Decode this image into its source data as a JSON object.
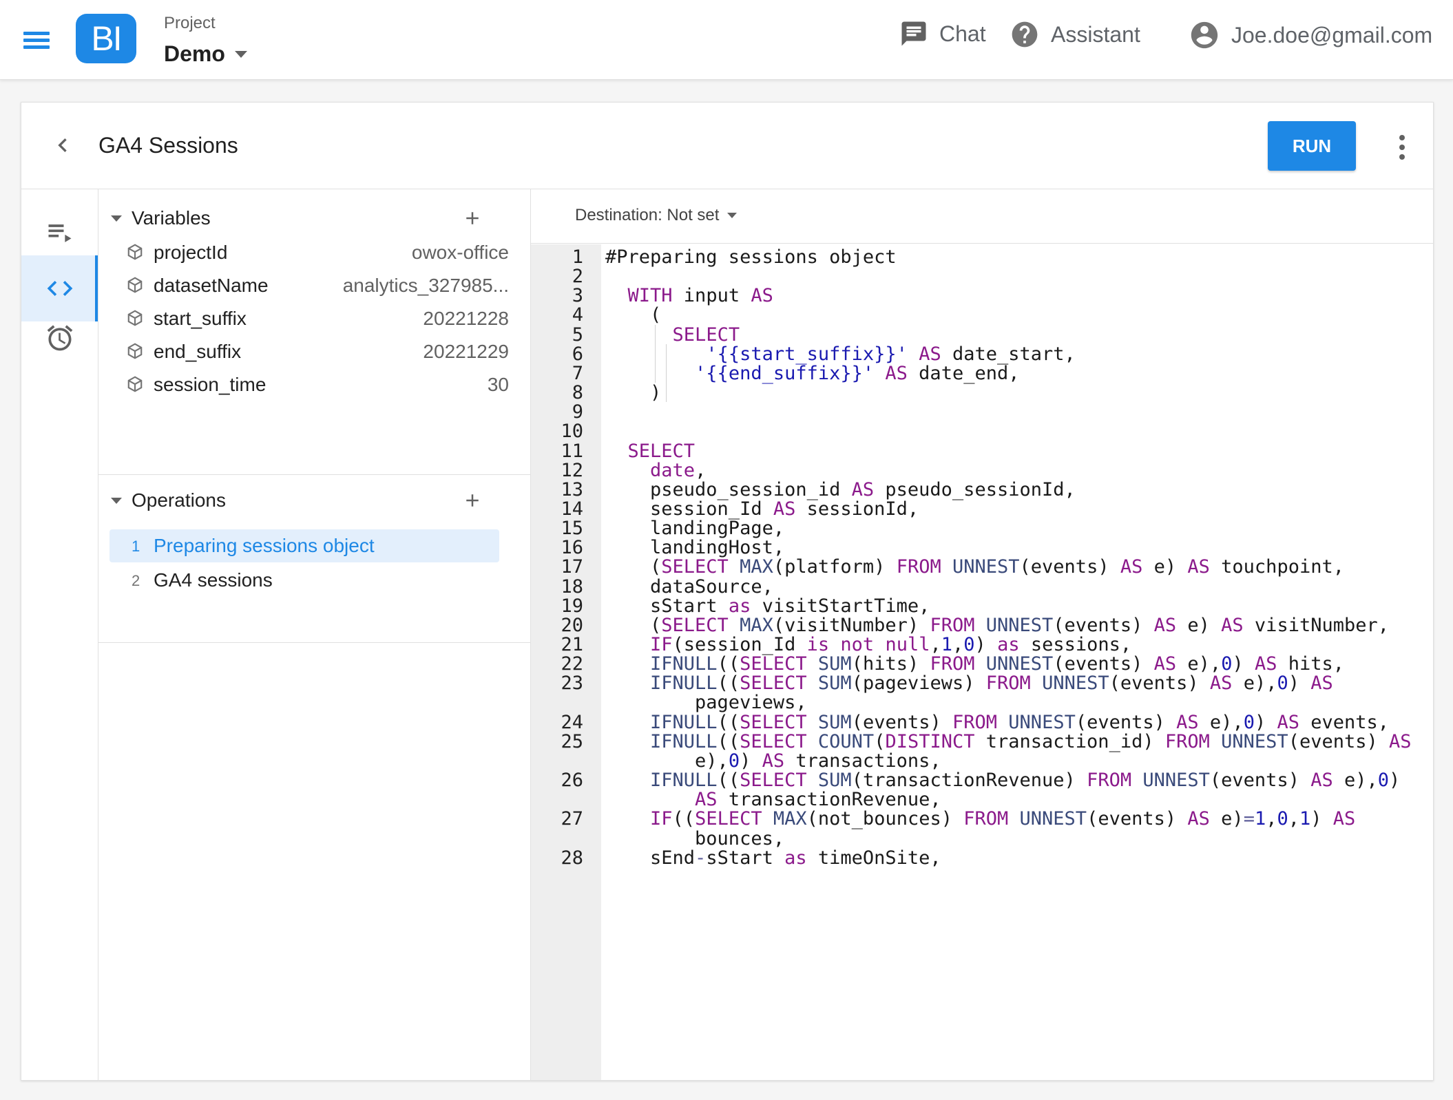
{
  "appbar": {
    "logo_text": "BI",
    "project_label": "Project",
    "project_name": "Demo",
    "chat_label": "Chat",
    "assistant_label": "Assistant",
    "user_email": "Joe.doe@gmail.com"
  },
  "query": {
    "title": "GA4 Sessions",
    "run_label": "RUN",
    "destination": "Destination: Not set"
  },
  "variables": {
    "header": "Variables",
    "items": [
      {
        "name": "projectId",
        "value": "owox-office"
      },
      {
        "name": "datasetName",
        "value": "analytics_327985..."
      },
      {
        "name": "start_suffix",
        "value": "20221228"
      },
      {
        "name": "end_suffix",
        "value": "20221229"
      },
      {
        "name": "session_time",
        "value": "30"
      }
    ]
  },
  "operations": {
    "header": "Operations",
    "items": [
      {
        "num": "1",
        "label": "Preparing sessions object",
        "active": true
      },
      {
        "num": "2",
        "label": "GA4 sessions",
        "active": false
      }
    ]
  },
  "editor": {
    "lines": [
      {
        "n": "1",
        "code": "#Preparing sessions object"
      },
      {
        "n": "2",
        "code": ""
      },
      {
        "n": "3",
        "code": "  WITH input AS"
      },
      {
        "n": "4",
        "code": "    ("
      },
      {
        "n": "5",
        "code": "      SELECT"
      },
      {
        "n": "6",
        "code": "         '{{start_suffix}}' AS date_start,"
      },
      {
        "n": "7",
        "code": "        '{{end_suffix}}' AS date_end,"
      },
      {
        "n": "8",
        "code": "    )"
      },
      {
        "n": "9",
        "code": ""
      },
      {
        "n": "10",
        "code": ""
      },
      {
        "n": "11",
        "code": "  SELECT"
      },
      {
        "n": "12",
        "code": "    date,"
      },
      {
        "n": "13",
        "code": "    pseudo_session_id AS pseudo_sessionId,"
      },
      {
        "n": "14",
        "code": "    session_Id AS sessionId,"
      },
      {
        "n": "15",
        "code": "    landingPage,"
      },
      {
        "n": "16",
        "code": "    landingHost,"
      },
      {
        "n": "17",
        "code": "    (SELECT MAX(platform) FROM UNNEST(events) AS e) AS touchpoint,"
      },
      {
        "n": "18",
        "code": "    dataSource,"
      },
      {
        "n": "19",
        "code": "    sStart as visitStartTime,"
      },
      {
        "n": "20",
        "code": "    (SELECT MAX(visitNumber) FROM UNNEST(events) AS e) AS visitNumber,"
      },
      {
        "n": "21",
        "code": "    IF(session_Id is not null,1,0) as sessions,"
      },
      {
        "n": "22",
        "code": "    IFNULL((SELECT SUM(hits) FROM UNNEST(events) AS e),0) AS hits,"
      },
      {
        "n": "23",
        "code": "    IFNULL((SELECT SUM(pageviews) FROM UNNEST(events) AS e),0) AS"
      },
      {
        "n": "",
        "code": "        pageviews,"
      },
      {
        "n": "24",
        "code": "    IFNULL((SELECT SUM(events) FROM UNNEST(events) AS e),0) AS events,"
      },
      {
        "n": "25",
        "code": "    IFNULL((SELECT COUNT(DISTINCT transaction_id) FROM UNNEST(events) AS"
      },
      {
        "n": "",
        "code": "        e),0) AS transactions,"
      },
      {
        "n": "26",
        "code": "    IFNULL((SELECT SUM(transactionRevenue) FROM UNNEST(events) AS e),0)"
      },
      {
        "n": "",
        "code": "        AS transactionRevenue,"
      },
      {
        "n": "27",
        "code": "    IF((SELECT MAX(not_bounces) FROM UNNEST(events) AS e)=1,0,1) AS"
      },
      {
        "n": "",
        "code": "        bounces,"
      },
      {
        "n": "28",
        "code": "    sEnd-sStart as timeOnSite,"
      }
    ]
  },
  "colors": {
    "accent": "#1e88e5",
    "keyword": "#8b1a8b",
    "function": "#3a4a7a",
    "string": "#1a1ab0"
  },
  "icons": {
    "menu": "menu-icon",
    "chat": "chat-icon",
    "assistant": "help-icon",
    "user": "account-icon",
    "back": "chevron-left-icon",
    "more": "more-vert-icon",
    "rail": [
      "playlist-play-icon",
      "code-icon",
      "alarm-icon"
    ],
    "variable": "cube-icon",
    "add": "plus-icon"
  }
}
